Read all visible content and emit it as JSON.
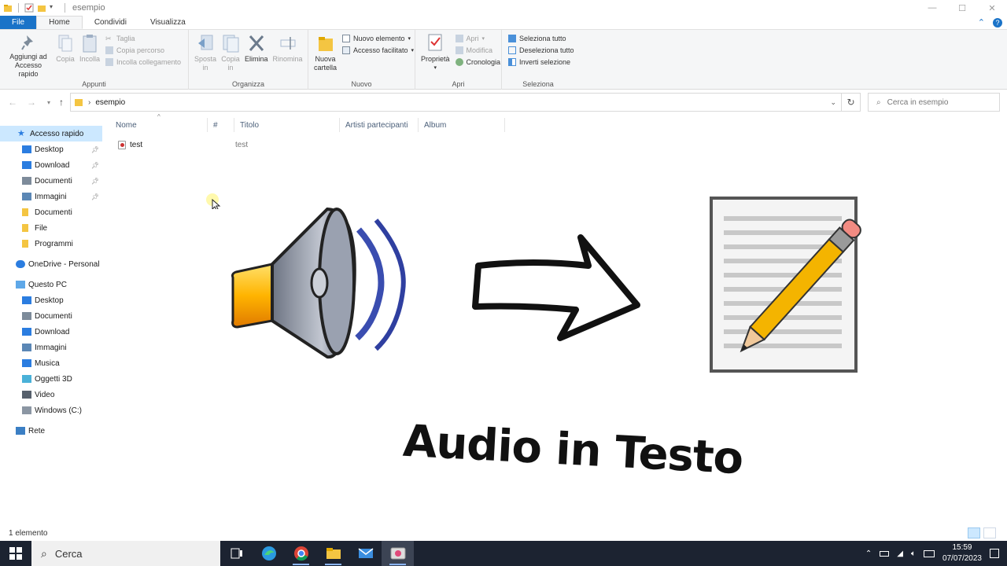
{
  "window": {
    "title": "esempio",
    "minimize": "—",
    "maximize": "☐",
    "close": "✕"
  },
  "tabs": [
    {
      "label": "File"
    },
    {
      "label": "Home"
    },
    {
      "label": "Condividi"
    },
    {
      "label": "Visualizza"
    }
  ],
  "ribbon": {
    "clipboard": {
      "label": "Appunti",
      "pin": "Aggiungi ad Accesso rapido",
      "copy": "Copia",
      "paste": "Incolla",
      "cut": "Taglia",
      "copy_path": "Copia percorso",
      "paste_shortcut": "Incolla collegamento"
    },
    "organize": {
      "label": "Organizza",
      "move": "Sposta in",
      "copyto": "Copia in",
      "delete": "Elimina",
      "rename": "Rinomina"
    },
    "new": {
      "label": "Nuovo",
      "new_folder": "Nuova cartella",
      "new_item": "Nuovo elemento",
      "easy_access": "Accesso facilitato"
    },
    "open": {
      "label": "Apri",
      "properties": "Proprietà",
      "open": "Apri",
      "edit": "Modifica",
      "history": "Cronologia"
    },
    "select": {
      "label": "Seleziona",
      "select_all": "Seleziona tutto",
      "select_none": "Deseleziona tutto",
      "invert": "Inverti selezione"
    }
  },
  "address": {
    "path": "esempio",
    "search_placeholder": "Cerca in esempio"
  },
  "nav": {
    "quick_access": "Accesso rapido",
    "quick_items": [
      {
        "label": "Desktop",
        "icon": "desktop-icon",
        "pinned": true
      },
      {
        "label": "Download",
        "icon": "download-icon",
        "pinned": true
      },
      {
        "label": "Documenti",
        "icon": "documents-icon",
        "pinned": true
      },
      {
        "label": "Immagini",
        "icon": "pictures-icon",
        "pinned": true
      },
      {
        "label": "Documenti",
        "icon": "folder-icon",
        "pinned": false
      },
      {
        "label": "File",
        "icon": "folder-icon",
        "pinned": false
      },
      {
        "label": "Programmi",
        "icon": "folder-icon",
        "pinned": false
      }
    ],
    "onedrive": "OneDrive - Personal",
    "this_pc": "Questo PC",
    "pc_items": [
      {
        "label": "Desktop",
        "icon": "desktop-icon"
      },
      {
        "label": "Documenti",
        "icon": "documents-icon"
      },
      {
        "label": "Download",
        "icon": "download-icon"
      },
      {
        "label": "Immagini",
        "icon": "pictures-icon"
      },
      {
        "label": "Musica",
        "icon": "music-icon"
      },
      {
        "label": "Oggetti 3D",
        "icon": "3d-objects-icon"
      },
      {
        "label": "Video",
        "icon": "video-icon"
      },
      {
        "label": "Windows (C:)",
        "icon": "drive-icon"
      }
    ],
    "network": "Rete"
  },
  "columns": [
    "Nome",
    "#",
    "Titolo",
    "Artisti partecipanti",
    "Album"
  ],
  "files": [
    {
      "name": "test",
      "number": "",
      "title": "test",
      "artists": "",
      "album": ""
    }
  ],
  "artwork": {
    "caption": "Audio in Testo"
  },
  "status": {
    "count": "1 elemento"
  },
  "taskbar": {
    "search": "Cerca",
    "time": "15:59",
    "date": "07/07/2023"
  },
  "colors": {
    "accent": "#1a73c8",
    "selected": "#cce8ff",
    "taskbar": "#1c2331"
  }
}
